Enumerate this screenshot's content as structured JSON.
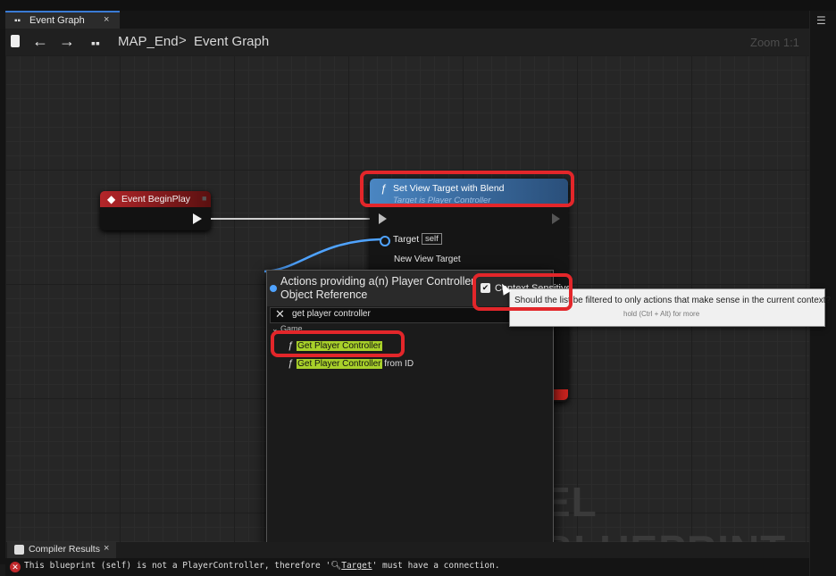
{
  "tab": {
    "icon": "graph-icon",
    "label": "Event Graph",
    "close": "×"
  },
  "breadcrumb": {
    "back": "←",
    "forward": "→",
    "map": "MAP_End",
    "separator": ">",
    "graph": "Event Graph",
    "zoom": "Zoom 1:1"
  },
  "watermark": "EL BLUEPRINT",
  "nodes": {
    "begin_play": {
      "title": "Event BeginPlay",
      "color": "#b3262a"
    },
    "set_view_target": {
      "title": "Set View Target with Blend",
      "subtitle": "Target is Player Controller",
      "target_label": "Target",
      "self_label": "self",
      "new_view_target_label": "New View Target",
      "color": "#4a86c2"
    }
  },
  "action_menu": {
    "title_line1": "Actions providing a(n) Player Controller",
    "title_line2": "Object Reference",
    "context_label": "Context Sensitive",
    "context_checked": true,
    "search_value": "get player controller",
    "category": "Game",
    "items": [
      {
        "highlight": "Get Player Controller",
        "rest": ""
      },
      {
        "highlight": "Get Player Controller",
        "rest": " from ID"
      }
    ]
  },
  "tooltip": {
    "line1": "Should the list be filtered to only actions that make sense in the current context?",
    "line2": "hold (Ctrl + Alt) for more"
  },
  "bottom": {
    "tab_label": "Compiler Results",
    "tab_close": "×",
    "error_prefix": "This blueprint (self) is not a PlayerController, therefore '",
    "error_link": "Target",
    "error_suffix": "' must have a connection."
  },
  "colors": {
    "highlight": "#e3262a",
    "search_match": "#a8d02a",
    "accent": "#3a7bd5"
  }
}
